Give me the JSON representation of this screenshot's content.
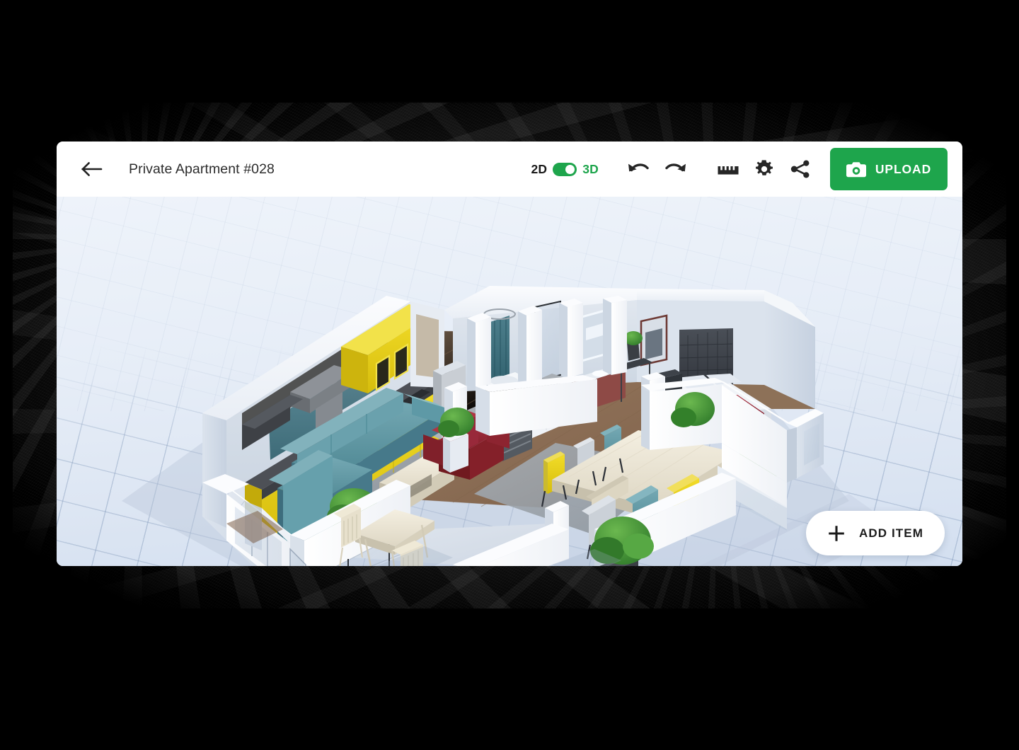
{
  "window": {
    "background_color": "#000000",
    "surface_color": "#ffffff"
  },
  "header": {
    "back_icon": "arrow-left-icon",
    "title": "Private Apartment #028",
    "view_mode": {
      "left_label": "2D",
      "right_label": "3D",
      "active": "3D",
      "toggle_on_color": "#1ea54c",
      "inactive_label_color": "#1a1a1a"
    },
    "tools": [
      {
        "name": "undo-button",
        "icon": "undo-icon"
      },
      {
        "name": "redo-button",
        "icon": "redo-icon"
      },
      {
        "name": "ruler-button",
        "icon": "ruler-icon"
      },
      {
        "name": "gear-button",
        "icon": "gear-icon"
      },
      {
        "name": "share-button",
        "icon": "share-icon"
      }
    ],
    "upload": {
      "label": "UPLOAD",
      "icon": "camera-icon",
      "background_color": "#1ea54c",
      "text_color": "#ffffff"
    }
  },
  "viewport": {
    "background_color": "#e3ebf5",
    "grid_color": "#8fa6c6",
    "render_mode": "3D isometric floor plan"
  },
  "fab": {
    "label": "ADD ITEM",
    "icon": "plus-icon",
    "background_color": "#ffffff",
    "text_color": "#1b1b1b"
  },
  "floor_plan": {
    "rooms": [
      {
        "name": "Kitchen",
        "accent_color": "#e8cf1e",
        "features": "yellow cabinets, range hood, oven, teal tile backsplash, dark countertop"
      },
      {
        "name": "Living Room",
        "accent_color": "#5f9aa6",
        "features": "teal L-shaped sectional sofa, red armchair, cream coffee table, grey rug, potted shrub"
      },
      {
        "name": "Hallway",
        "accent_color": "#d9dde2",
        "features": "tall wardrobe, low sideboard with open shelving, planters"
      },
      {
        "name": "Bathroom",
        "accent_color": "#3c7f8c",
        "features": "teal shower curtain, glass shower enclosure, bathtub, vanity, lit mirror"
      },
      {
        "name": "Bedroom",
        "accent_color": "#3b414a",
        "features": "double bed, dark tufted headboard, red throw, nightstand, framed art"
      },
      {
        "name": "Dining Area",
        "accent_color": "#efe6cf",
        "features": "cream dining table, six chairs in yellow / grey / teal, grey rug, large plant"
      },
      {
        "name": "Balcony",
        "accent_color": "#cfd8e2",
        "features": "folding table, two folding chairs, glass railing, potted tree"
      }
    ],
    "palette": {
      "wall": "#f2f4f7",
      "wall_shadow": "#c9d3e0",
      "floor_wood": "#9b7d62",
      "floor_tile": "#dfe5ec",
      "rug": "#9aa1a8",
      "yellow": "#e8cf1e",
      "teal": "#5f9aa6",
      "red": "#9e2733",
      "plant_green": "#3f8a33"
    }
  }
}
